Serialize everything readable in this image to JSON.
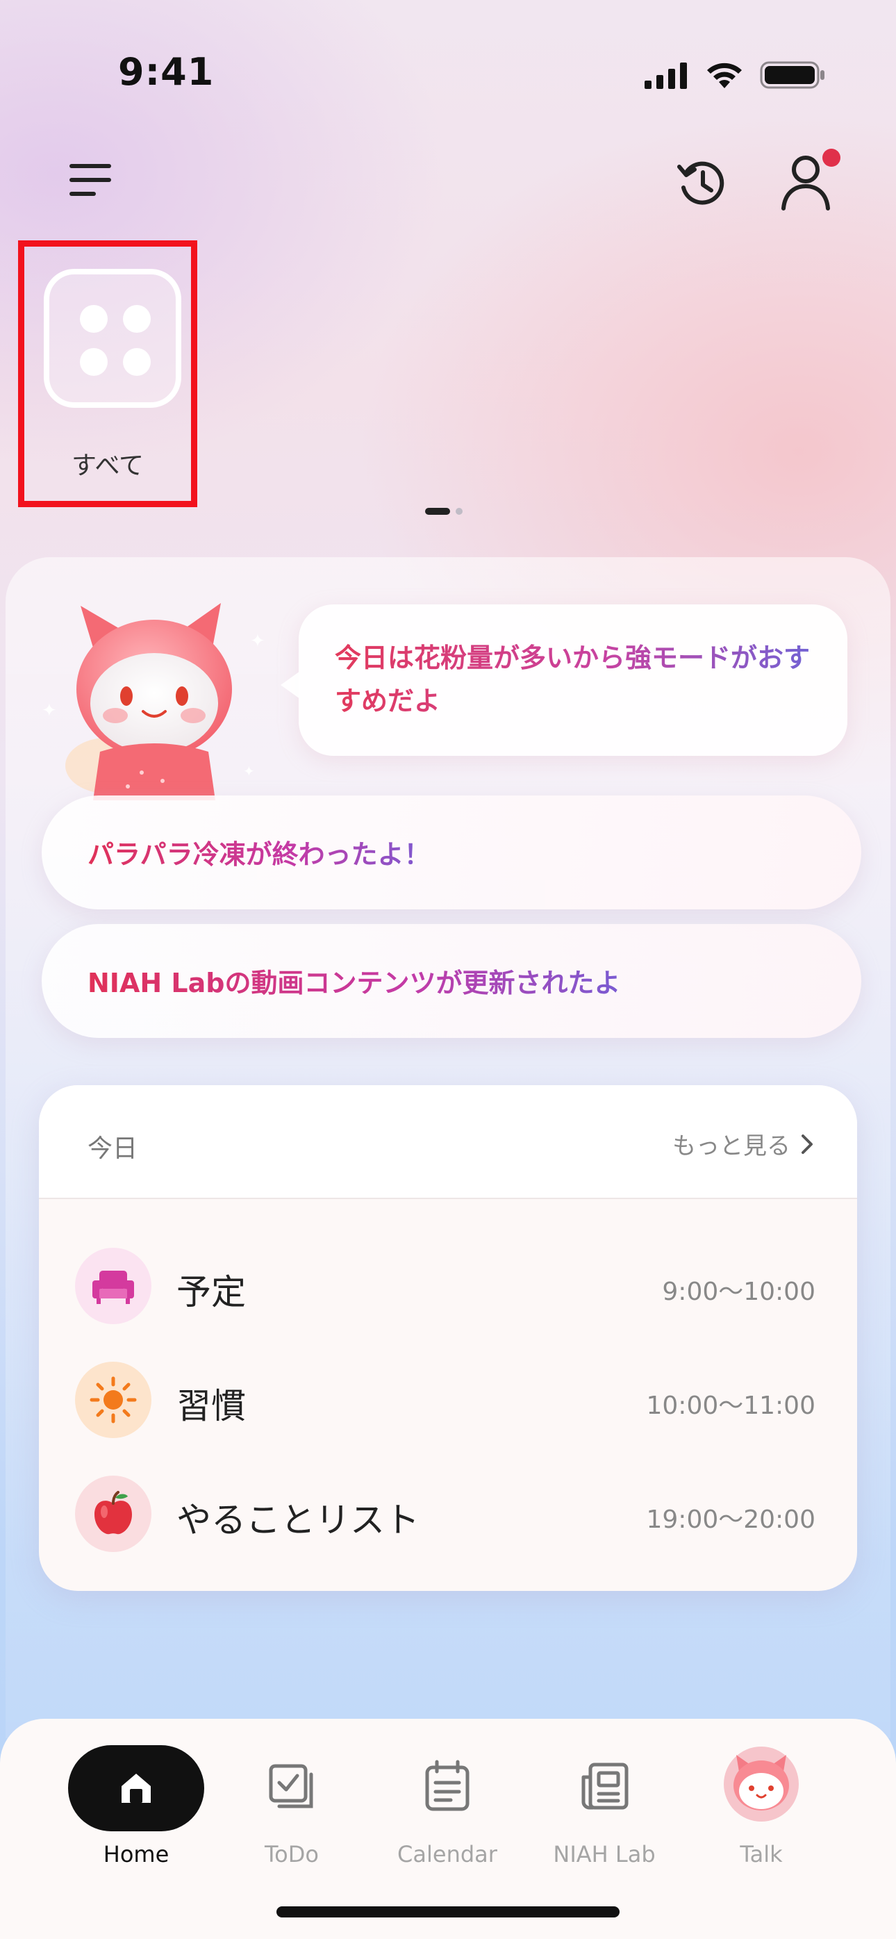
{
  "status_bar": {
    "time": "9:41"
  },
  "header": {
    "menu_icon": "hamburger-menu-icon",
    "history_icon": "history-icon",
    "profile_icon": "profile-icon",
    "notification_dot_color": "#e0304a"
  },
  "category": {
    "label": "すべて",
    "icon": "grid-four-dots-icon",
    "selected": true
  },
  "pager": {
    "pages": 2,
    "current": 1
  },
  "assistant": {
    "message": "今日は花粉量が多いから強モードがおすすめだよ"
  },
  "notifications": [
    {
      "text": "パラパラ冷凍が終わったよ！"
    },
    {
      "text": "NIAH Labの動画コンテンツが更新されたよ"
    }
  ],
  "today": {
    "title": "今日",
    "more_label": "もっと見る",
    "items": [
      {
        "label": "予定",
        "time": "9:00～10:00",
        "icon": "sofa-icon",
        "icon_bg": "#fbe3f1",
        "icon_color": "#d43a9e"
      },
      {
        "label": "習慣",
        "time": "10:00～11:00",
        "icon": "sun-icon",
        "icon_bg": "#fde4cc",
        "icon_color": "#f37a1c"
      },
      {
        "label": "やることリスト",
        "time": "19:00～20:00",
        "icon": "apple-icon",
        "icon_bg": "#fadde0",
        "icon_color": "#e2323e"
      }
    ]
  },
  "bottom_nav": [
    {
      "label": "Home",
      "icon": "home-icon",
      "active": true
    },
    {
      "label": "ToDo",
      "icon": "todo-check-icon",
      "active": false
    },
    {
      "label": "Calendar",
      "icon": "calendar-icon",
      "active": false
    },
    {
      "label": "NIAH Lab",
      "icon": "newspaper-icon",
      "active": false
    },
    {
      "label": "Talk",
      "icon": "mascot-avatar-icon",
      "active": false
    }
  ]
}
